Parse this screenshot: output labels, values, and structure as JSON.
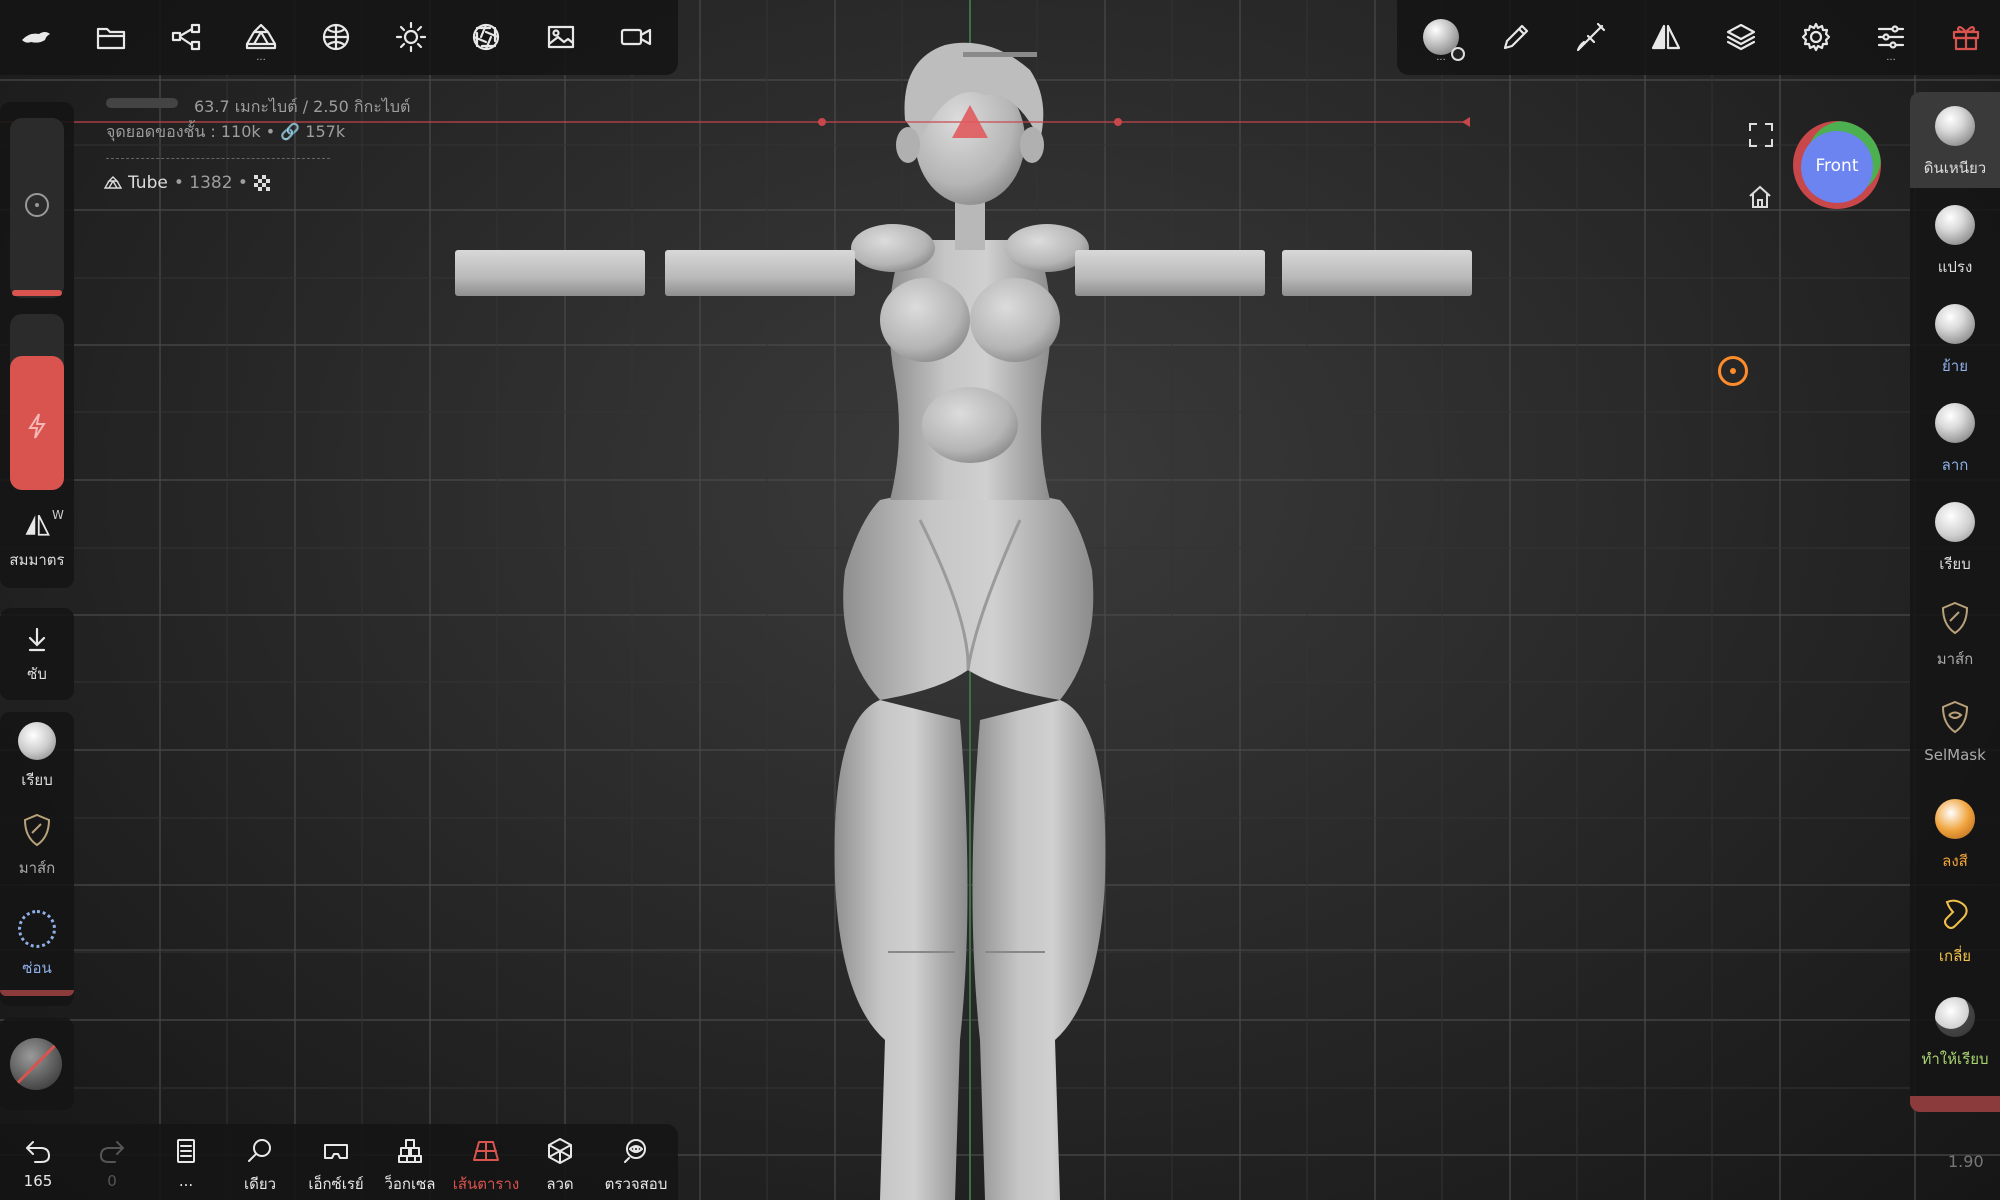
{
  "top_toolbar": {
    "items": [
      {
        "name": "app-menu",
        "icon": "nomad-logo-icon"
      },
      {
        "name": "files",
        "icon": "folder-icon"
      },
      {
        "name": "scene",
        "icon": "scene-graph-icon"
      },
      {
        "name": "topology",
        "icon": "topology-icon",
        "more": "..."
      },
      {
        "name": "material",
        "icon": "material-sphere-icon"
      },
      {
        "name": "lighting",
        "icon": "sun-icon"
      },
      {
        "name": "camera-settings",
        "icon": "aperture-icon"
      },
      {
        "name": "background",
        "icon": "image-icon"
      },
      {
        "name": "video",
        "icon": "video-camera-icon"
      }
    ]
  },
  "top_right_toolbar": {
    "items": [
      {
        "name": "tool-settings",
        "icon": "tool-settings-sphere-icon",
        "more": "..."
      },
      {
        "name": "stroke",
        "icon": "pencil-icon"
      },
      {
        "name": "painting",
        "icon": "brush-icon"
      },
      {
        "name": "symmetry",
        "icon": "symmetry-icon"
      },
      {
        "name": "layers",
        "icon": "layers-icon"
      },
      {
        "name": "settings",
        "icon": "gear-icon"
      },
      {
        "name": "interface",
        "icon": "sliders-icon",
        "more": "..."
      },
      {
        "name": "gift",
        "icon": "gift-icon"
      }
    ]
  },
  "info": {
    "memory": "63.7 เมกะไบต์ / 2.50 กิกะไบต์",
    "vertices": "จุดยอดของชั้น :  110k • ",
    "vertices_link": "157k",
    "object_name": "Tube",
    "object_count": "• 1382 •"
  },
  "view": {
    "cube_label": "Front",
    "cube_colors": {
      "top": "#4caf50",
      "left": "#d9534f",
      "center": "#6b84f0"
    }
  },
  "left_panel": {
    "symmetry_label": "สมมาตร",
    "symmetry_corner": "W",
    "sub_label": "ซับ",
    "smooth_label": "เรียบ",
    "mask_label": "มาส์ก",
    "hide_label": "ซ่อน"
  },
  "right_tools": [
    {
      "label": "ดินเหนียว",
      "icon": "clay-sphere-icon",
      "active": true
    },
    {
      "label": "แปรง",
      "icon": "brush-sphere-icon"
    },
    {
      "label": "ย้าย",
      "icon": "move-sphere-icon"
    },
    {
      "label": "ลาก",
      "icon": "drag-sphere-icon"
    },
    {
      "label": "เรียบ",
      "icon": "smooth-sphere-icon"
    },
    {
      "label": "มาส์ก",
      "icon": "mask-shield-icon"
    },
    {
      "label": "SelMask",
      "icon": "selmask-shield-icon"
    },
    {
      "label": "ลงสี",
      "icon": "paint-sphere-icon"
    },
    {
      "label": "เกลี่ย",
      "icon": "smudge-icon"
    },
    {
      "label": "ทำให้เรียบ",
      "icon": "flatten-sphere-icon"
    }
  ],
  "bottom_toolbar": {
    "undo_count": "165",
    "redo_count": "0",
    "items": [
      {
        "label": "",
        "icon": "undo-icon"
      },
      {
        "label": "",
        "icon": "redo-icon"
      },
      {
        "label": "...",
        "icon": "document-icon"
      },
      {
        "label": "เดียว",
        "icon": "search-icon"
      },
      {
        "label": "เอ็กซ์เรย์",
        "icon": "xray-glasses-icon"
      },
      {
        "label": "ว็อกเซล",
        "icon": "voxel-icon"
      },
      {
        "label": "เส้นตาราง",
        "icon": "grid-floor-icon",
        "active": true
      },
      {
        "label": "ลวด",
        "icon": "wireframe-icon"
      },
      {
        "label": "ตรวจสอบ",
        "icon": "inspect-icon"
      }
    ]
  },
  "version": "1.90",
  "colors": {
    "accent_red": "#d9534f",
    "active_orange": "#ff8c2a",
    "guide_red": "#c8474a",
    "label_blue": "#8fb0e8",
    "label_green": "#a8d470",
    "label_orange": "#f0a33c"
  }
}
